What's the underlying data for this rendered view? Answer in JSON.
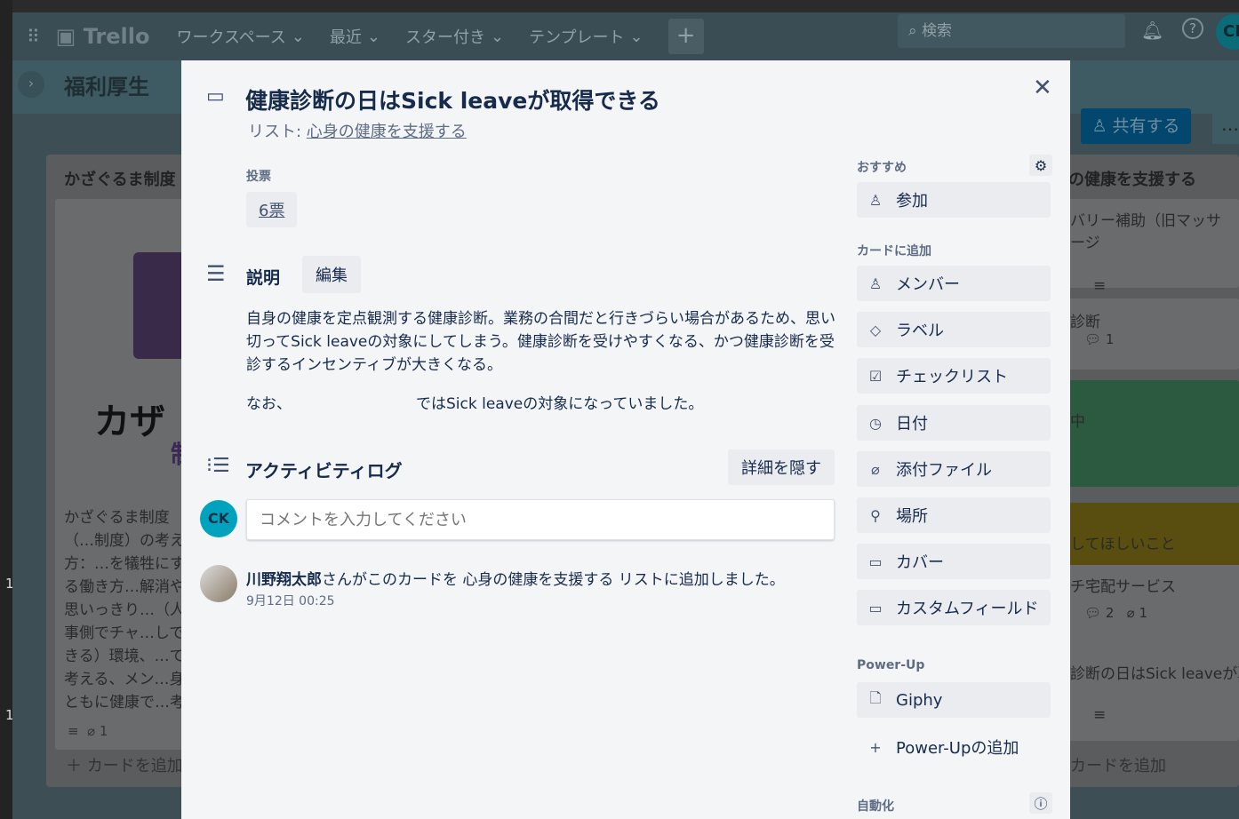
{
  "left_numbers": [
    "1",
    "1"
  ],
  "topbar": {
    "logo": "Trello",
    "nav": [
      "ワークスペース",
      "最近",
      "スター付き",
      "テンプレート"
    ],
    "add": "+",
    "search_placeholder": "検索",
    "avatar": "CK"
  },
  "board": {
    "title": "福利厚生",
    "share": "共有する",
    "more": "…",
    "left_list": {
      "title": "かざぐるま制度",
      "cover_text": "カザ",
      "cover_sub": "制",
      "card_text": "かざぐるま制度（…制度）の考え方：…を犠牲にする働き方…解消や思いっきり…（人事側でチャ…しできる）環境、…て考える、メン…身ともに健康で…考える",
      "attach": "1",
      "add": "＋ カードを追加"
    },
    "right_list": {
      "title": "の健康を支援する",
      "cards": [
        {
          "text": "バリー補助（旧マッサージ"
        },
        {
          "text": "診断",
          "comments": "1"
        },
        {
          "text": "中"
        },
        {
          "text": "してほしいこと"
        },
        {
          "text": "チ宅配サービス",
          "comments": "2",
          "attach": "1"
        },
        {
          "text": "診断の日はSick leaveが取"
        }
      ],
      "add": "カードを追加"
    }
  },
  "modal": {
    "title": "健康診断の日はSick leaveが取得できる",
    "list_prefix": "リスト: ",
    "list_name": "心身の健康を支援する",
    "votes_label": "投票",
    "votes": "6票",
    "desc_label": "説明",
    "edit": "編集",
    "desc_p1": "自身の健康を定点観測する健康診断。業務の合間だと行きづらい場合があるため、思い切ってSick leaveの対象にしてしまう。健康診断を受けやすくなる、かつ健康診断を受診するインセンティブが大きくなる。",
    "desc_p2a": "なお、",
    "desc_p2b": "ではSick leaveの対象になっていました。",
    "activity_label": "アクティビティログ",
    "hide_details": "詳細を隠す",
    "comment_avatar": "CK",
    "comment_placeholder": "コメントを入力してください",
    "log": {
      "user": "川野翔太郎",
      "text": "さんがこのカードを 心身の健康を支援する リストに追加しました。",
      "time": "9月12日 00:25"
    },
    "sidebar": {
      "suggested": "おすすめ",
      "join": "参加",
      "add_to_card": "カードに追加",
      "items": [
        "メンバー",
        "ラベル",
        "チェックリスト",
        "日付",
        "添付ファイル",
        "場所",
        "カバー",
        "カスタムフィールド"
      ],
      "powerup_label": "Power-Up",
      "giphy": "Giphy",
      "add_powerup": "Power-Upの追加",
      "automation": "自動化"
    }
  }
}
